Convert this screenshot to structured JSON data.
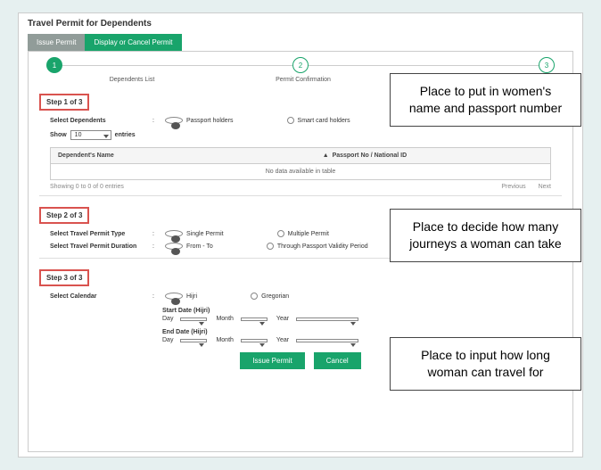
{
  "page_title": "Travel Permit for Dependents",
  "tabs": {
    "issue": "Issue Permit",
    "display": "Display or Cancel Permit"
  },
  "stepper": {
    "s1": "1",
    "s2": "2",
    "s3": "3",
    "l1": "Dependents List",
    "l2": "Permit Confirmation"
  },
  "step1": {
    "heading": "Step 1 of 3",
    "select_dependents": "Select Dependents",
    "passport_holders": "Passport holders",
    "smart_card_holders": "Smart card holders",
    "show": "Show",
    "show_value": "10",
    "entries": "entries",
    "col_name": "Dependent's Name",
    "col_id": "Passport No / National ID",
    "no_data": "No data available in table",
    "showing": "Showing 0 to 0 of 0 entries",
    "prev": "Previous",
    "next": "Next",
    "arrow": "▲"
  },
  "step2": {
    "heading": "Step 2 of 3",
    "permit_type": "Select Travel Permit Type",
    "single": "Single Permit",
    "multiple": "Multiple Permit",
    "duration": "Select Travel Permit Duration",
    "from_to": "From - To",
    "validity": "Through Passport Validity Period"
  },
  "step3": {
    "heading": "Step 3 of 3",
    "calendar": "Select Calendar",
    "hijri": "Hijri",
    "gregorian": "Gregorian",
    "start_date": "Start Date (Hijri)",
    "end_date": "End Date (Hijri)",
    "day": "Day",
    "month": "Month",
    "year": "Year"
  },
  "buttons": {
    "issue": "Issue Permit",
    "cancel": "Cancel"
  },
  "annotations": {
    "a1": "Place to put in women's name and passport number",
    "a2": "Place to decide how many journeys a woman can take",
    "a3": "Place to input how long woman can travel for"
  }
}
